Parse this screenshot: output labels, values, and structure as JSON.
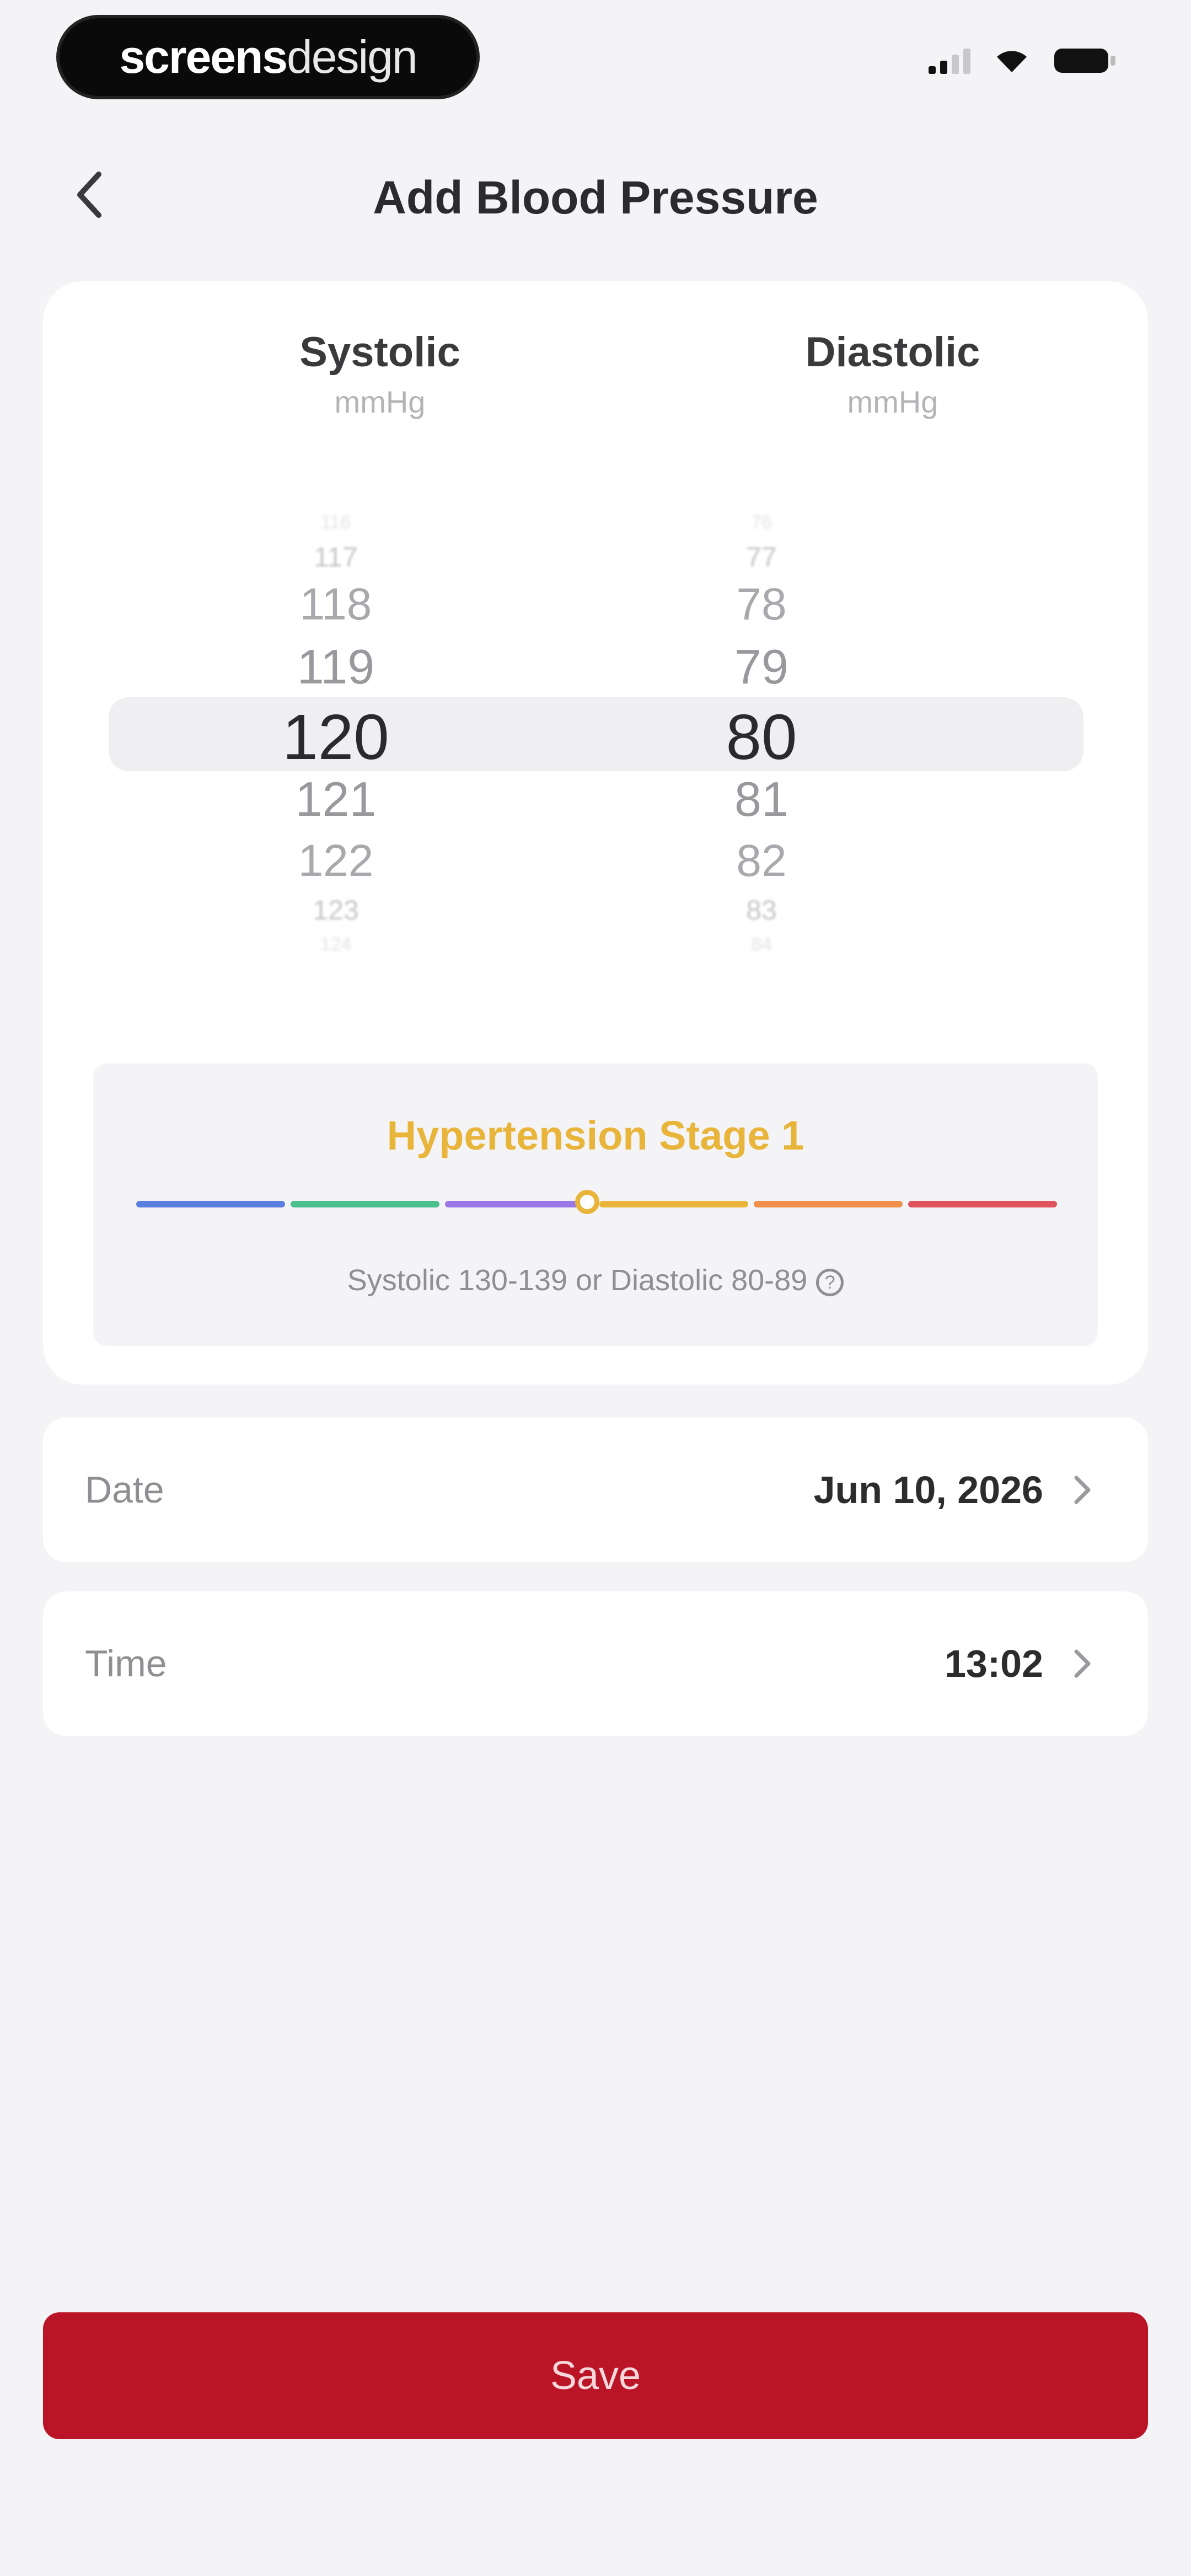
{
  "status_bar": {
    "brand_bold": "screens",
    "brand_light": "design"
  },
  "header": {
    "title": "Add Blood Pressure"
  },
  "picker": {
    "systolic": {
      "label": "Systolic",
      "unit": "mmHg",
      "values": [
        "116",
        "117",
        "118",
        "119",
        "120",
        "121",
        "122",
        "123",
        "124"
      ],
      "selected": "120"
    },
    "diastolic": {
      "label": "Diastolic",
      "unit": "mmHg",
      "values": [
        "76",
        "77",
        "78",
        "79",
        "80",
        "81",
        "82",
        "83",
        "84"
      ],
      "selected": "80"
    }
  },
  "stage": {
    "title": "Hypertension Stage 1",
    "description": "Systolic 130-139 or Diastolic 80-89",
    "info_icon": "info-icon",
    "segment_colors": [
      "#5b7fe0",
      "#4cbf8f",
      "#9a78e6",
      "#e8b53a",
      "#f0904a",
      "#e0525c"
    ],
    "active_segment": 4,
    "marker_position": 0.49
  },
  "date_row": {
    "label": "Date",
    "value": "Jun 10, 2026"
  },
  "time_row": {
    "label": "Time",
    "value": "13:02"
  },
  "save_label": "Save",
  "colors": {
    "primary": "#ba1526",
    "stage_accent": "#e8b53a",
    "background": "#f4f4f7"
  }
}
